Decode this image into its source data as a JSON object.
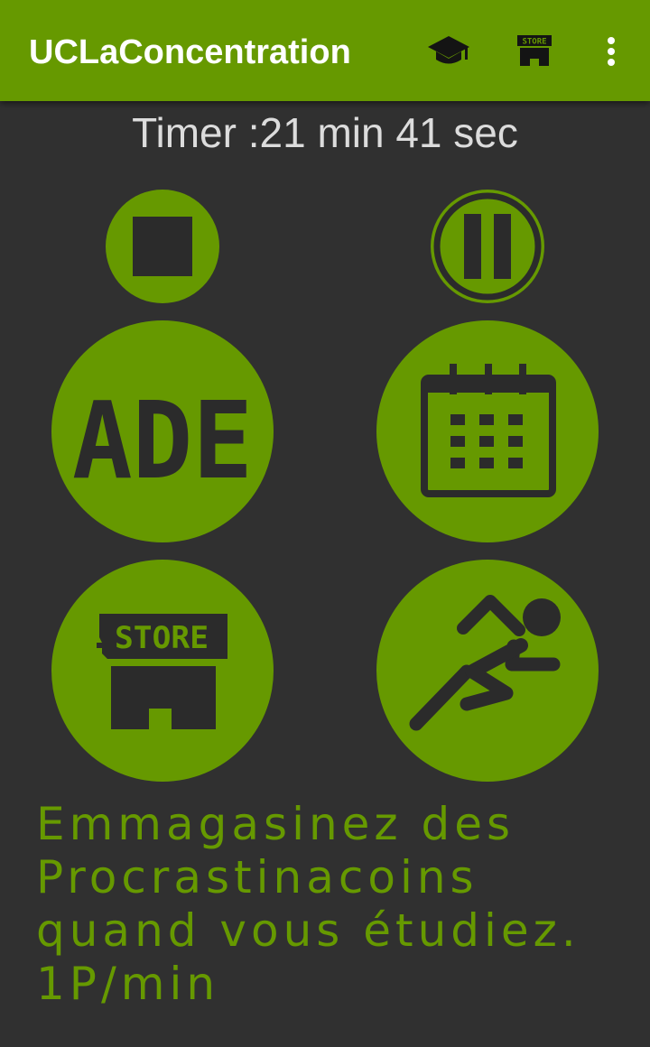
{
  "appbar": {
    "title": "UCLaConcentration",
    "icons": [
      "graduation-cap-icon",
      "store-icon",
      "more-vert-icon"
    ]
  },
  "timer": {
    "text": "Timer :21 min 41 sec"
  },
  "controls": {
    "stop_icon": "stop-icon",
    "pause_icon": "pause-icon"
  },
  "grid": {
    "ade_label": "ADE",
    "calendar_icon": "calendar-icon",
    "store_label": "STORE",
    "runner_icon": "runner-icon"
  },
  "tagline": {
    "text": "Emmagasinez des\nProcrastinacoins\nquand vous étudiez.\n1P/min"
  },
  "colors": {
    "accent": "#669900",
    "background": "#303030",
    "dark": "#2b2b2b",
    "appbar_text": "#ffffff",
    "timer_text": "#dcdcdc"
  }
}
